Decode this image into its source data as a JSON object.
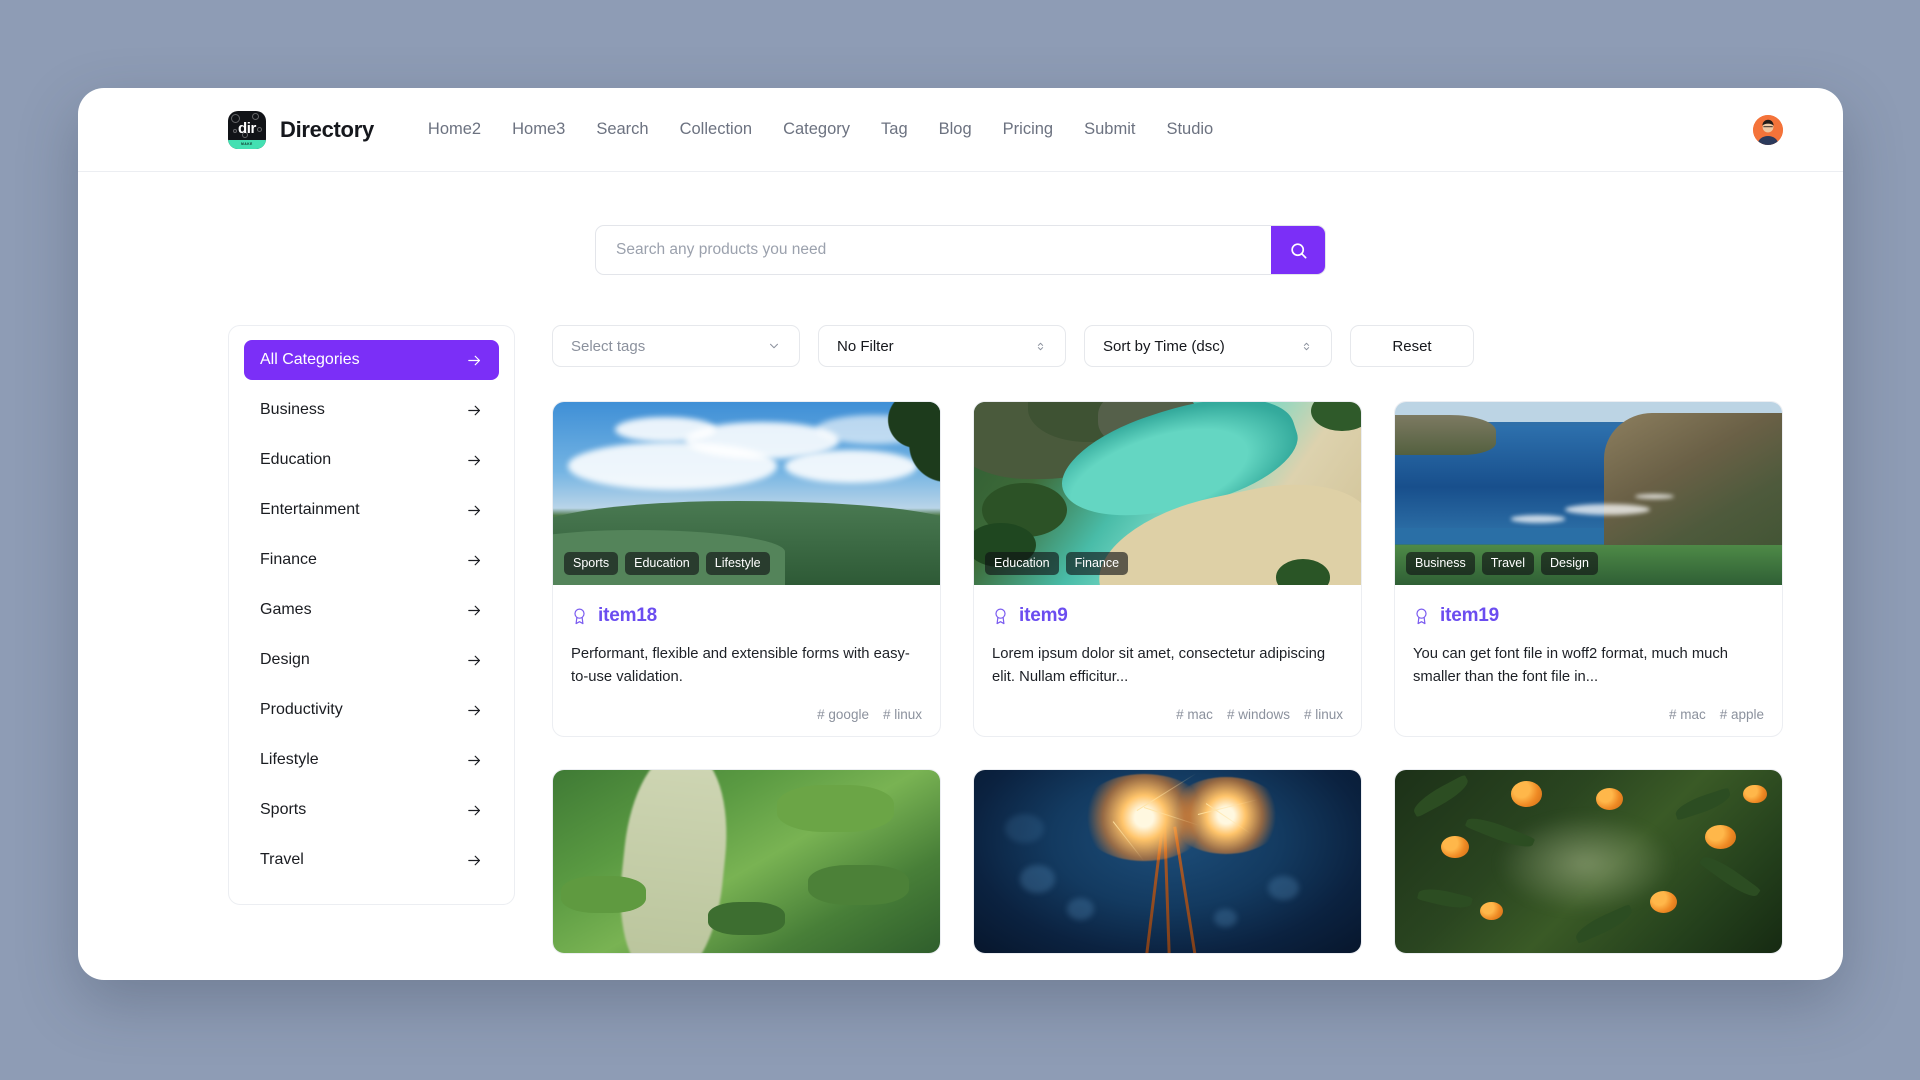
{
  "brand": {
    "logo_text": "dir",
    "logo_footer_text": "MAKE",
    "name": "Directory"
  },
  "nav": {
    "links": [
      {
        "label": "Home2"
      },
      {
        "label": "Home3"
      },
      {
        "label": "Search"
      },
      {
        "label": "Collection"
      },
      {
        "label": "Category"
      },
      {
        "label": "Tag"
      },
      {
        "label": "Blog"
      },
      {
        "label": "Pricing"
      },
      {
        "label": "Submit"
      },
      {
        "label": "Studio"
      }
    ],
    "avatar_name": "user-avatar"
  },
  "search": {
    "placeholder": "Search any products you need",
    "value": "",
    "button_icon": "search-icon"
  },
  "sidebar": {
    "items": [
      {
        "label": "All Categories",
        "active": true
      },
      {
        "label": "Business",
        "active": false
      },
      {
        "label": "Education",
        "active": false
      },
      {
        "label": "Entertainment",
        "active": false
      },
      {
        "label": "Finance",
        "active": false
      },
      {
        "label": "Games",
        "active": false
      },
      {
        "label": "Design",
        "active": false
      },
      {
        "label": "Productivity",
        "active": false
      },
      {
        "label": "Lifestyle",
        "active": false
      },
      {
        "label": "Sports",
        "active": false
      },
      {
        "label": "Travel",
        "active": false
      }
    ]
  },
  "filters": {
    "tags_label": "Select tags",
    "filter_label": "No Filter",
    "sort_label": "Sort by Time (dsc)",
    "reset_label": "Reset"
  },
  "colors": {
    "accent": "#7b2ff7",
    "title": "#6b4df0",
    "page_bg": "#8e9cb5",
    "logo_accent": "#44e0b2"
  },
  "cards": [
    {
      "title": "item18",
      "description": "Performant, flexible and extensible forms with easy-to-use validation.",
      "categories": [
        "Sports",
        "Education",
        "Lifestyle"
      ],
      "hashtags": [
        "# google",
        "# linux"
      ],
      "image": "mountain-landscape"
    },
    {
      "title": "item9",
      "description": "Lorem ipsum dolor sit amet, consectetur adipiscing elit. Nullam efficitur...",
      "categories": [
        "Education",
        "Finance"
      ],
      "hashtags": [
        "# mac",
        "# windows",
        "# linux"
      ],
      "image": "tropical-cove"
    },
    {
      "title": "item19",
      "description": "You can get font file in woff2 format, much much smaller than the font file in...",
      "categories": [
        "Business",
        "Travel",
        "Design"
      ],
      "hashtags": [
        "# mac",
        "# apple"
      ],
      "image": "sea-cliffs"
    },
    {
      "title": "",
      "description": "",
      "categories": [],
      "hashtags": [],
      "image": "aerial-fields"
    },
    {
      "title": "",
      "description": "",
      "categories": [],
      "hashtags": [],
      "image": "sparklers"
    },
    {
      "title": "",
      "description": "",
      "categories": [],
      "hashtags": [],
      "image": "orange-grove"
    }
  ]
}
